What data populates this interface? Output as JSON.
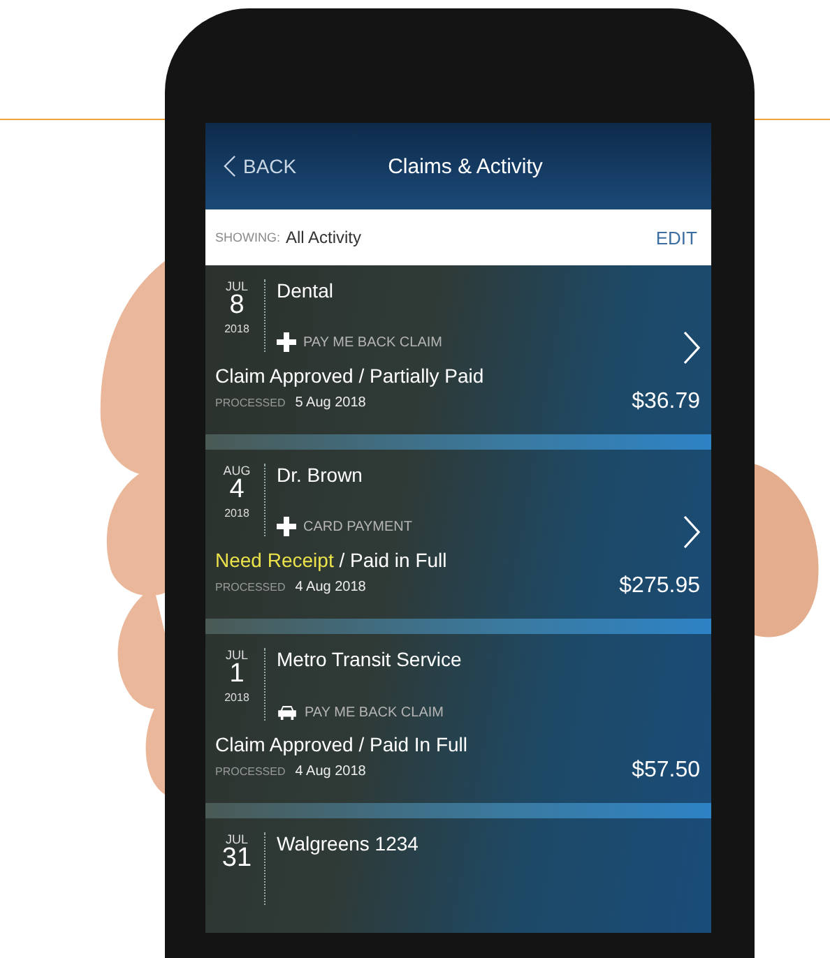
{
  "nav": {
    "back": "BACK",
    "title": "Claims & Activity"
  },
  "filter": {
    "label": "SHOWING:",
    "value": "All Activity",
    "action": "EDIT"
  },
  "activities": [
    {
      "month": "JUL",
      "day": "8",
      "year": "2018",
      "title": "Dental",
      "kind": "medical",
      "type": "PAY ME BACK CLAIM",
      "chevron": true,
      "status": [
        {
          "text": "Claim Approved / Partially Paid",
          "kind": "plain"
        }
      ],
      "processed_label": "PROCESSED",
      "processed_date": "5 Aug 2018",
      "amount": "$36.79"
    },
    {
      "month": "AUG",
      "day": "4",
      "year": "2018",
      "title": "Dr. Brown",
      "kind": "medical",
      "type": "CARD PAYMENT",
      "chevron": true,
      "status": [
        {
          "text": "Need Receipt",
          "kind": "alert"
        },
        {
          "text": "/ Paid in Full",
          "kind": "plain"
        }
      ],
      "processed_label": "PROCESSED",
      "processed_date": "4 Aug 2018",
      "amount": "$275.95"
    },
    {
      "month": "JUL",
      "day": "1",
      "year": "2018",
      "title": "Metro Transit Service",
      "kind": "car",
      "type": "PAY ME BACK CLAIM",
      "chevron": false,
      "status": [
        {
          "text": "Claim Approved / Paid In Full",
          "kind": "plain"
        }
      ],
      "processed_label": "PROCESSED",
      "processed_date": "4 Aug 2018",
      "amount": "$57.50"
    },
    {
      "month": "JUL",
      "day": "31",
      "title": "Walgreens 1234"
    }
  ]
}
